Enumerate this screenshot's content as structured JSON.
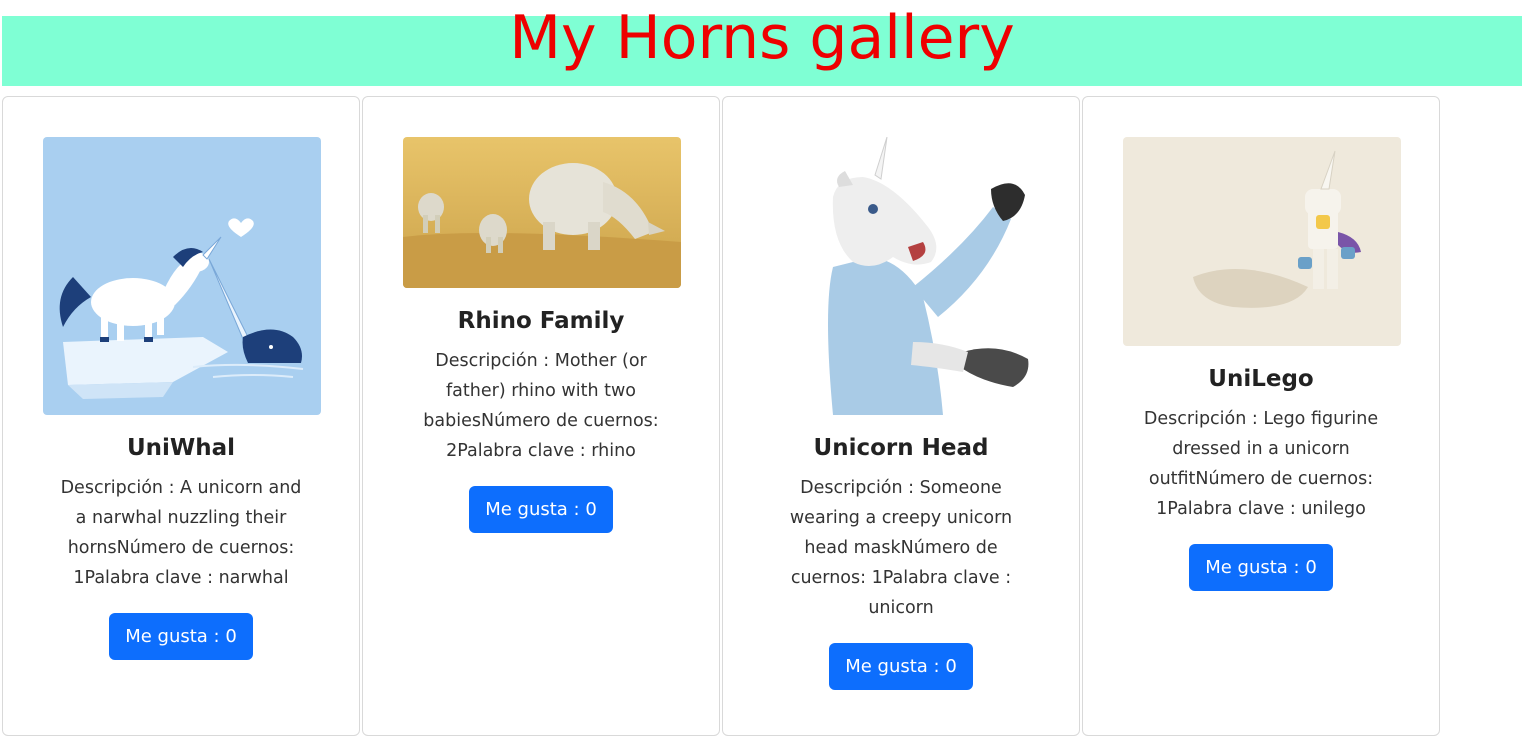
{
  "header": {
    "title": "My Horns gallery"
  },
  "cards": [
    {
      "title": "UniWhal",
      "description": "Descripción : A unicorn and a narwhal nuzzling their hornsNúmero de cuernos: 1Palabra clave : narwhal",
      "button_label": "Me gusta : 0",
      "image_icon": "unicorn-narwhal-illustration"
    },
    {
      "title": "Rhino Family",
      "description": "Descripción : Mother (or father) rhino with two babiesNúmero de cuernos: 2Palabra clave : rhino",
      "button_label": "Me gusta : 0",
      "image_icon": "rhino-family-photo"
    },
    {
      "title": "Unicorn Head",
      "description": "Descripción : Someone wearing a creepy unicorn head maskNúmero de cuernos: 1Palabra clave : unicorn",
      "button_label": "Me gusta : 0",
      "image_icon": "unicorn-mask-photo"
    },
    {
      "title": "UniLego",
      "description": "Descripción : Lego figurine dressed in a unicorn outfitNúmero de cuernos: 1Palabra clave : unilego",
      "button_label": "Me gusta : 0",
      "image_icon": "lego-unicorn-photo"
    }
  ],
  "colors": {
    "header_bg": "#7fffd4",
    "title": "#ee0000",
    "button": "#0d6efd"
  }
}
